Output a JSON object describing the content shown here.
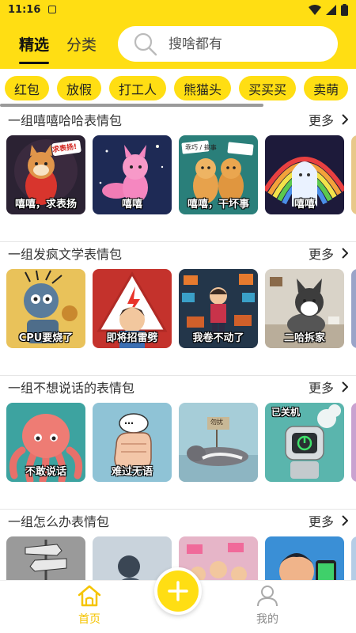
{
  "status_bar": {
    "time": "11:16"
  },
  "header": {
    "tabs": [
      {
        "label": "精选",
        "active": true
      },
      {
        "label": "分类",
        "active": false
      }
    ],
    "search": {
      "placeholder": "搜啥都有"
    }
  },
  "chips": [
    "红包",
    "放假",
    "打工人",
    "熊猫头",
    "买买买",
    "卖萌"
  ],
  "sections": [
    {
      "title": "一组嘻嘻哈哈表情包",
      "more": "更多",
      "items": [
        {
          "caption": "嘻嘻，求表扬",
          "sign": "求表扬!",
          "icon": "shiba-dog-icon"
        },
        {
          "caption": "嘻嘻",
          "sign": "",
          "icon": "pink-fox-icon"
        },
        {
          "caption": "嘻嘻，干坏事",
          "sign": "乖巧 / 搞事",
          "icon": "two-cats-icon"
        },
        {
          "caption": "嘻嘻",
          "sign": "",
          "icon": "ghost-rainbow-icon"
        }
      ]
    },
    {
      "title": "一组发疯文学表情包",
      "more": "更多",
      "items": [
        {
          "caption": "CPU要烧了",
          "sign": "",
          "icon": "robot-icon"
        },
        {
          "caption": "即将招雷劈",
          "sign": "",
          "icon": "lightning-sign-icon"
        },
        {
          "caption": "我卷不动了",
          "sign": "",
          "icon": "chaos-office-icon"
        },
        {
          "caption": "二哈拆家",
          "sign": "",
          "icon": "husky-icon"
        }
      ]
    },
    {
      "title": "一组不想说话的表情包",
      "more": "更多",
      "items": [
        {
          "caption": "不敢说话",
          "sign": "",
          "icon": "octopus-icon"
        },
        {
          "caption": "难过无语",
          "sign": "…",
          "icon": "fist-icon"
        },
        {
          "caption": "",
          "sign": "勿扰",
          "icon": "sleeping-cat-icon"
        },
        {
          "caption": "",
          "sign": "已关机",
          "icon": "shutdown-robot-icon"
        }
      ]
    },
    {
      "title": "一组怎么办表情包",
      "more": "更多",
      "items": [
        {
          "caption": "",
          "sign": "",
          "icon": "signpost-icon"
        },
        {
          "caption": "",
          "sign": "",
          "icon": "sad-person-icon"
        },
        {
          "caption": "",
          "sign": "",
          "icon": "crowd-icon"
        },
        {
          "caption": "",
          "sign": "",
          "icon": "phone-man-icon"
        }
      ]
    }
  ],
  "bottom_nav": {
    "home_label": "首页",
    "mine_label": "我的"
  },
  "colors": {
    "accent": "#FFDE13",
    "home_active": "#F5C400"
  }
}
